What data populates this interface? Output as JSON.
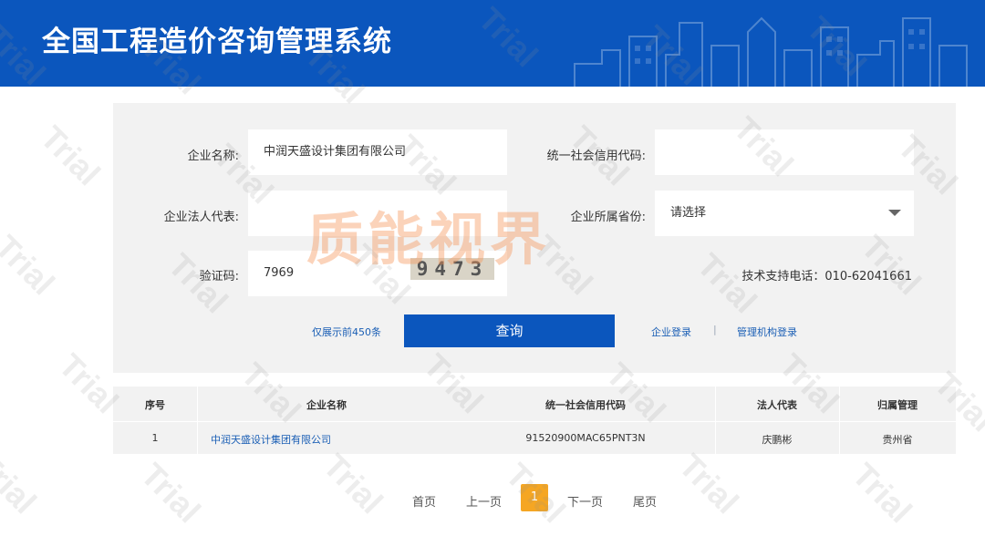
{
  "header": {
    "title": "全国工程造价咨询管理系统"
  },
  "form": {
    "company_name_label": "企业名称:",
    "company_name_value": "中润天盛设计集团有限公司",
    "credit_code_label": "统一社会信用代码:",
    "credit_code_value": "",
    "legal_rep_label": "企业法人代表:",
    "legal_rep_value": "",
    "province_label": "企业所属省份:",
    "province_value": "请选择",
    "captcha_label": "验证码:",
    "captcha_input_value": "7969",
    "captcha_image_text": "9473",
    "tech_support": "技术支持电话：010-62041661",
    "limit_note": "仅展示前450条",
    "query_button": "查询",
    "company_login": "企业登录",
    "separator": "|",
    "agency_login": "管理机构登录"
  },
  "table": {
    "columns": [
      "序号",
      "企业名称",
      "统一社会信用代码",
      "法人代表",
      "归属管理"
    ],
    "rows": [
      [
        "1",
        "中润天盛设计集团有限公司",
        "91520900MAC65PNT3N",
        "庆鹏彬",
        "贵州省"
      ]
    ]
  },
  "pagination": {
    "first": "首页",
    "prev": "上一页",
    "current": "1",
    "next": "下一页",
    "last": "尾页"
  },
  "overlay": {
    "brand_text": "质能视界",
    "watermark_text": "Trial"
  },
  "colors": {
    "header_bg": "#0b56bd",
    "button_bg": "#0b56bd",
    "link": "#1b5fb5",
    "current_page": "#f5a623",
    "panel_bg": "#f2f2f2"
  }
}
